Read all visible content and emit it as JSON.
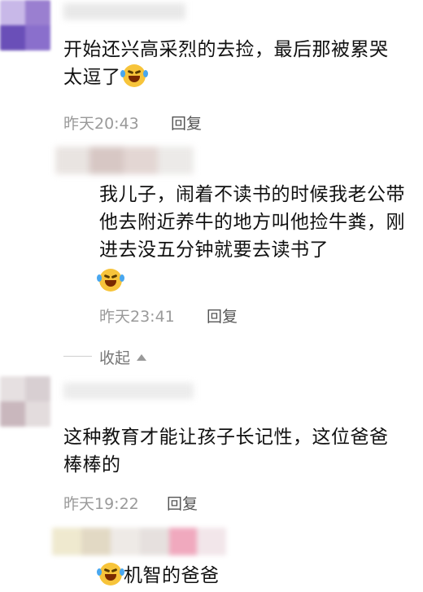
{
  "comments": [
    {
      "text": "开始还兴高采烈的去捡，最后那被累哭太逗了",
      "time": "昨天20:43",
      "reply_label": "回复"
    },
    {
      "text": "我儿子，闹着不读书的时候我老公带他去附近养牛的地方叫他捡牛粪，刚进去没五分钟就要去读书了",
      "time": "昨天23:41",
      "reply_label": "回复",
      "collapse_label": "收起"
    },
    {
      "text": "这种教育才能让孩子长记性，这位爸爸棒棒的",
      "time": "昨天19:22",
      "reply_label": "回复"
    },
    {
      "text": "机智的爸爸"
    }
  ],
  "icons": {
    "emoji": "laugh-cry-emoji-icon",
    "collapse": "triangle-up-icon"
  },
  "colors": {
    "meta": "#9a9a9a",
    "emoji": "#f7c43a"
  }
}
